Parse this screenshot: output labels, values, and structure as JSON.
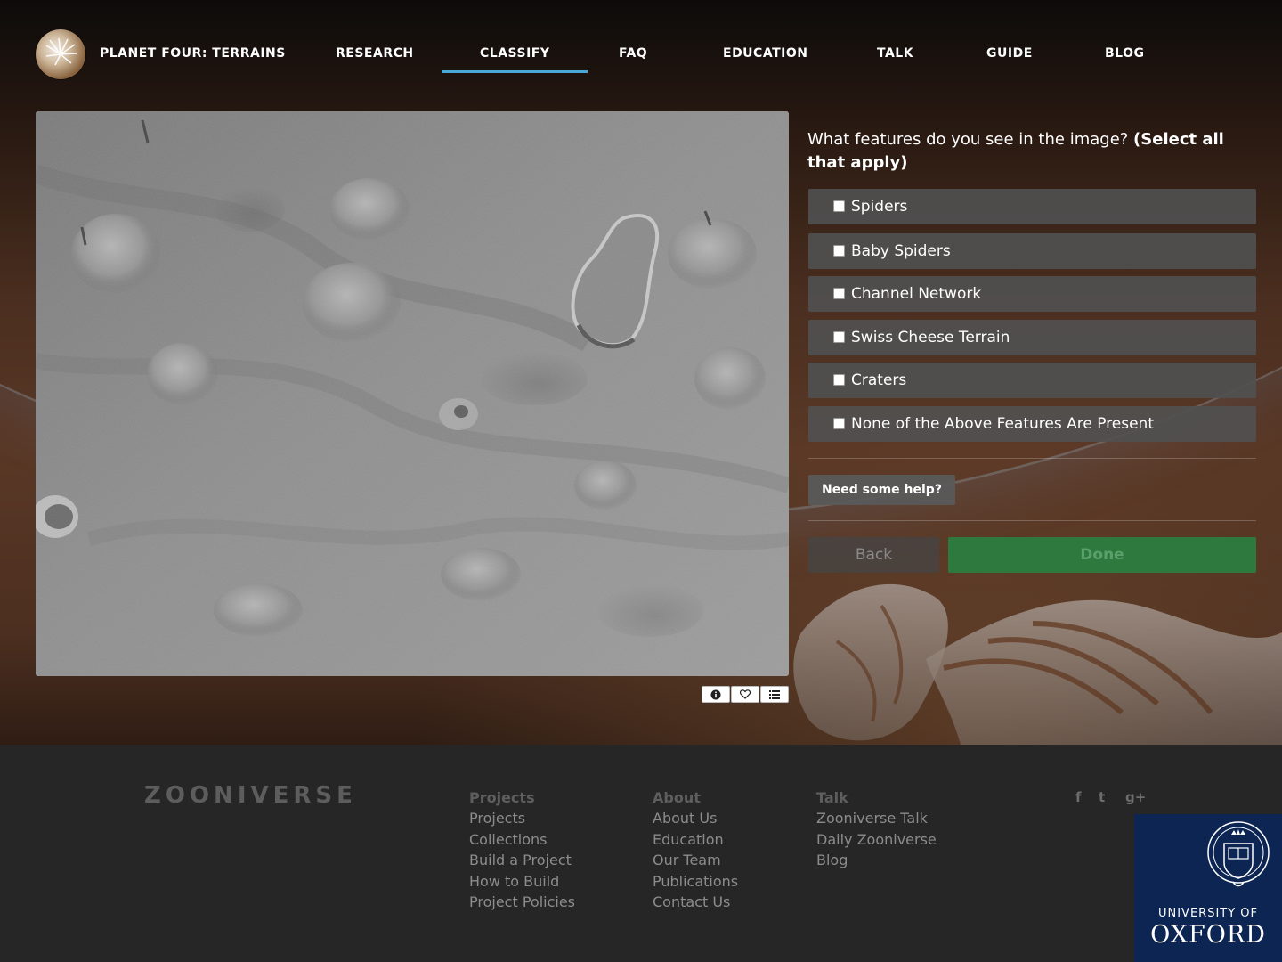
{
  "nav": {
    "brand": "PLANET FOUR: TERRAINS",
    "items": [
      {
        "label": "RESEARCH"
      },
      {
        "label": "CLASSIFY",
        "active": true
      },
      {
        "label": "FAQ"
      },
      {
        "label": "EDUCATION"
      },
      {
        "label": "TALK"
      },
      {
        "label": "GUIDE"
      },
      {
        "label": "BLOG"
      }
    ]
  },
  "subject": {
    "meta_buttons": [
      {
        "icon": "info-icon"
      },
      {
        "icon": "heart-icon"
      },
      {
        "icon": "list-icon"
      }
    ]
  },
  "task": {
    "question": "What features do you see in the image? ",
    "question_emphasis": "(Select all that apply)",
    "answers": [
      {
        "label": "Spiders",
        "checked": false
      },
      {
        "label": "Baby Spiders",
        "checked": false
      },
      {
        "label": "Channel Network",
        "checked": false
      },
      {
        "label": "Swiss Cheese Terrain",
        "checked": false
      },
      {
        "label": "Craters",
        "checked": false
      },
      {
        "label": "None of the Above Features Are Present",
        "checked": false
      }
    ],
    "help_label": "Need some help?",
    "back_label": "Back",
    "done_label": "Done"
  },
  "footer": {
    "logo": "ZOONIVERSE",
    "columns": [
      {
        "heading": "Projects",
        "links": [
          "Projects",
          "Collections",
          "Build a Project",
          "How to Build",
          "Project Policies"
        ]
      },
      {
        "heading": "About",
        "links": [
          "About Us",
          "Education",
          "Our Team",
          "Publications",
          "Contact Us"
        ]
      },
      {
        "heading": "Talk",
        "links": [
          "Zooniverse Talk",
          "Daily Zooniverse",
          "Blog"
        ]
      }
    ],
    "social": {
      "facebook": "f",
      "twitter": "t",
      "google_plus": "g+"
    },
    "oxford": {
      "line1": "UNIVERSITY OF",
      "line2": "OXFORD"
    }
  },
  "colors": {
    "active_tab": "#4aa8d8",
    "done_button": "#2e7a3e",
    "oxford_blue": "#0d2553",
    "footer_bg": "#262626"
  }
}
